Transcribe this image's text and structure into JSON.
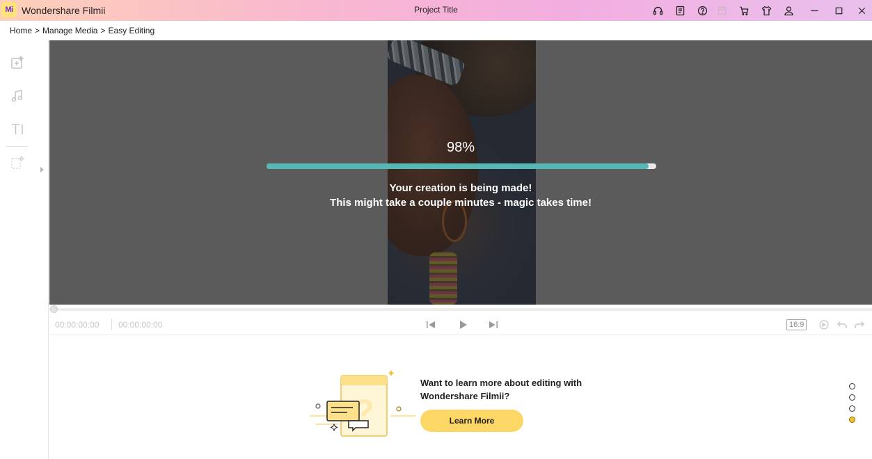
{
  "titlebar": {
    "logo_text": "Mi",
    "app_name": "Wondershare Filmii",
    "project_title": "Project Title",
    "icons": [
      "headset-icon",
      "notes-icon",
      "help-icon",
      "save-icon",
      "cart-icon",
      "shirt-icon",
      "user-icon",
      "minimize-icon",
      "maximize-icon",
      "close-icon"
    ]
  },
  "breadcrumb": {
    "items": [
      "Home",
      "Manage Media",
      "Easy Editing"
    ],
    "separator": ">"
  },
  "sidebar": {
    "items": [
      "add-media-icon",
      "music-icon",
      "text-icon",
      "sticker-icon"
    ]
  },
  "preview": {
    "progress_label": "98%",
    "progress_value": 0.98,
    "message_line1": "Your creation is being made!",
    "message_line2": "This might take a couple minutes - magic takes time!"
  },
  "controls": {
    "current_time": "00:00:00:00",
    "total_time": "00:00:00:00",
    "aspect_ratio": "16:9"
  },
  "learn_more": {
    "text": "Want to learn more about editing with Wondershare Filmii?",
    "button_label": "Learn More"
  },
  "carousel": {
    "count": 4,
    "active_index": 3
  },
  "colors": {
    "accent_progress": "#55b8b4",
    "button_yellow": "#fdd766"
  }
}
